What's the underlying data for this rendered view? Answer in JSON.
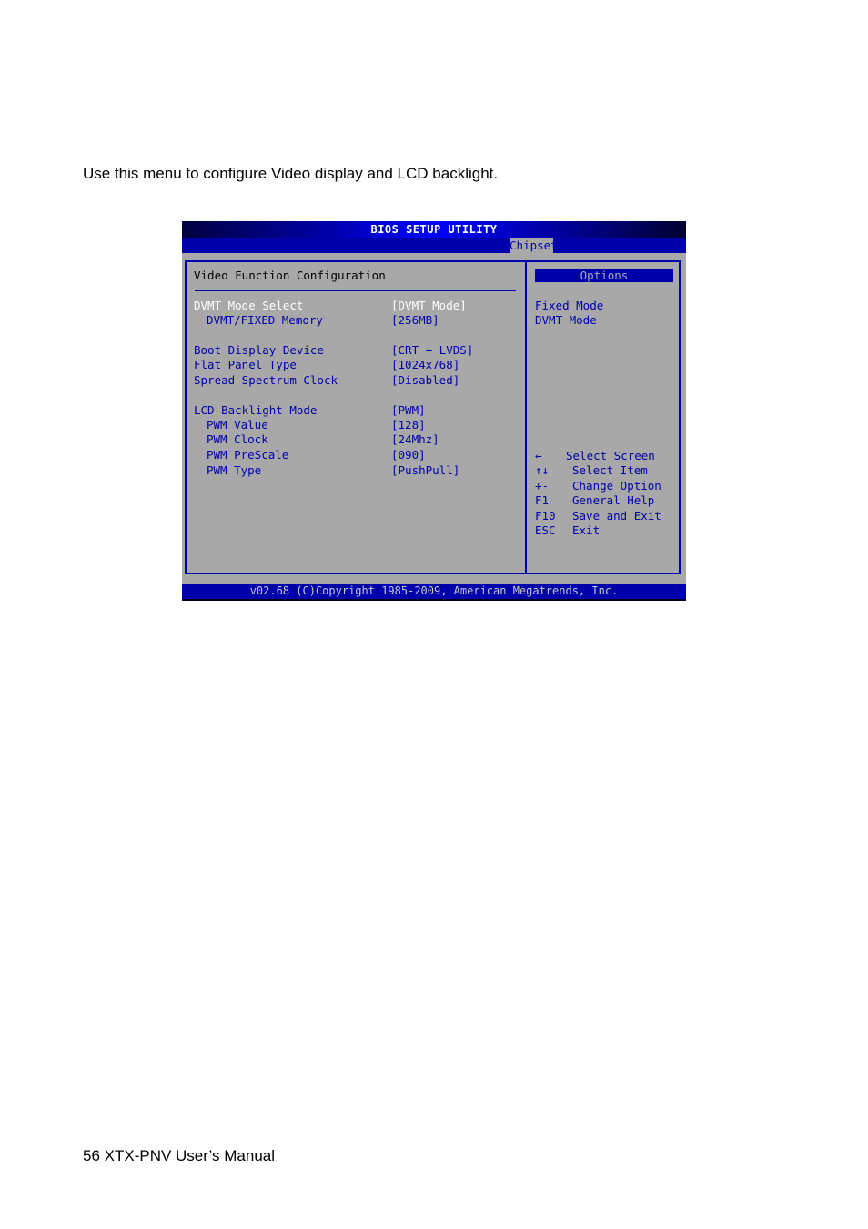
{
  "page": {
    "intro_text": "Use this menu to configure Video display and LCD backlight.",
    "footer_text": "56 XTX-PNV User’s Manual"
  },
  "bios": {
    "title": "BIOS SETUP UTILITY",
    "active_tab": "Chipset",
    "section_title": "Video Function Configuration",
    "items": [
      {
        "label": "DVMT Mode Select",
        "value": "[DVMT Mode]",
        "sub": false,
        "selected": true
      },
      {
        "label": "DVMT/FIXED Memory",
        "value": "[256MB]",
        "sub": true,
        "selected": false
      },
      {
        "label": "Boot Display Device",
        "value": "[CRT + LVDS]",
        "sub": false,
        "selected": false
      },
      {
        "label": "Flat Panel Type",
        "value": "[1024x768]",
        "sub": false,
        "selected": false
      },
      {
        "label": "Spread Spectrum Clock",
        "value": "[Disabled]",
        "sub": false,
        "selected": false
      },
      {
        "label": "LCD Backlight Mode",
        "value": "[PWM]",
        "sub": false,
        "selected": false
      },
      {
        "label": "PWM Value",
        "value": "[128]",
        "sub": true,
        "selected": false
      },
      {
        "label": "PWM Clock",
        "value": "[24Mhz]",
        "sub": true,
        "selected": false
      },
      {
        "label": "PWM PreScale",
        "value": "[090]",
        "sub": true,
        "selected": false
      },
      {
        "label": "PWM Type",
        "value": "[PushPull]",
        "sub": true,
        "selected": false
      }
    ],
    "options_header": "Options",
    "options": [
      "Fixed Mode",
      "DVMT Mode"
    ],
    "keys": [
      {
        "key": "←",
        "desc": "Select Screen",
        "icon": "arrow-left-icon"
      },
      {
        "key": "↑↓",
        "desc": "Select Item",
        "icon": "arrow-up-down-icon"
      },
      {
        "key": "+-",
        "desc": "Change Option",
        "icon": "plus-minus-icon"
      },
      {
        "key": "F1",
        "desc": "General Help"
      },
      {
        "key": "F10",
        "desc": "Save and Exit"
      },
      {
        "key": "ESC",
        "desc": "Exit"
      }
    ],
    "copyright": "v02.68 (C)Copyright 1985-2009, American Megatrends, Inc."
  },
  "colors": {
    "bios_blue": "#0000aa",
    "bios_gray": "#a8a8a8",
    "selected_text": "#ffffff"
  }
}
